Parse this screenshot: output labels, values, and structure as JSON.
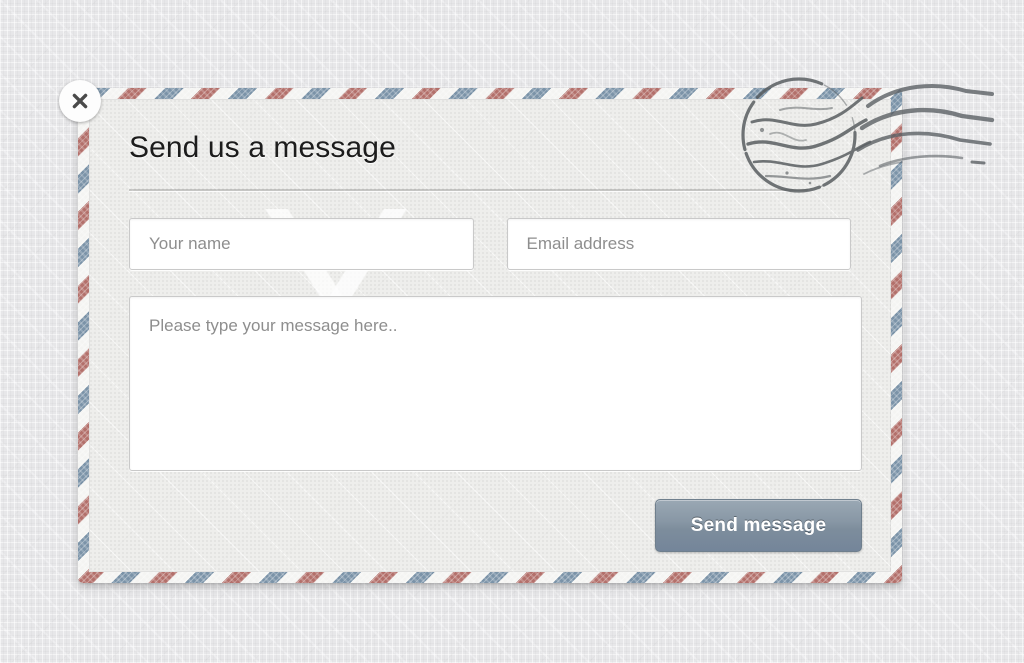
{
  "background": {
    "color": "#e7e7e9",
    "texture": "linen"
  },
  "dialog": {
    "name": "contact-form-envelope",
    "style": "airmail-envelope",
    "paper_color": "#eeeeec",
    "stripe_colors": {
      "red": "#b3706b",
      "blue": "#7b93a8",
      "white": "#f4f4f2"
    },
    "close_button": {
      "icon": "close-x-icon",
      "label": "×"
    },
    "title": "Send us a message",
    "postmark": {
      "icon": "postmark-stamp-icon",
      "ink_color": "#555a5d"
    },
    "form": {
      "name_field": {
        "placeholder": "Your name",
        "value": ""
      },
      "email_field": {
        "placeholder": "Email address",
        "value": ""
      },
      "message_field": {
        "placeholder": "Please type your message here..",
        "value": ""
      },
      "submit_button": {
        "label": "Send message",
        "color": "#8897a5"
      }
    }
  }
}
